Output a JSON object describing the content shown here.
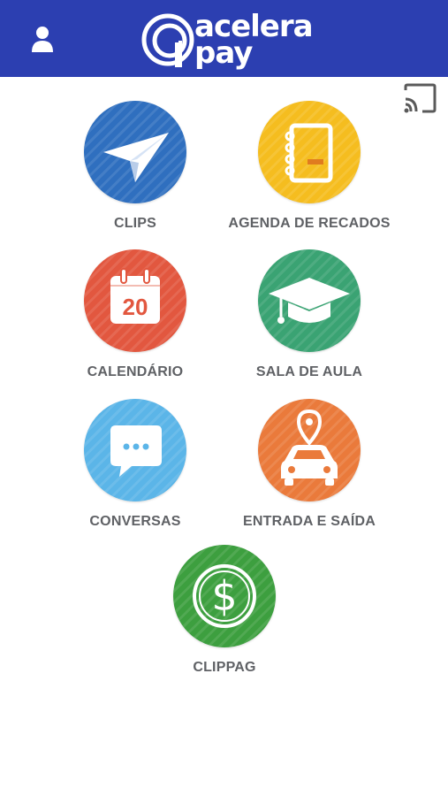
{
  "header": {
    "logo_word1": "acelera",
    "logo_word2": "pay",
    "background": "#2c3fb1"
  },
  "icons": {
    "user": "user-icon",
    "cast": "cast-icon"
  },
  "menu": [
    {
      "label": "CLIPS",
      "color": "#2f6fbf",
      "icon": "paper-plane-icon"
    },
    {
      "label": "AGENDA DE RECADOS",
      "color": "#f5bd1f",
      "icon": "notebook-icon"
    },
    {
      "label": "CALENDÁRIO",
      "color": "#e2573f",
      "icon": "calendar-icon",
      "day": "20"
    },
    {
      "label": "SALA DE AULA",
      "color": "#3aa373",
      "icon": "graduation-cap-icon"
    },
    {
      "label": "CONVERSAS",
      "color": "#5bb5e8",
      "icon": "chat-bubble-icon"
    },
    {
      "label": "ENTRADA E SAÍDA",
      "color": "#ea7a3b",
      "icon": "car-location-icon"
    },
    {
      "label": "CLIPPAG",
      "color": "#3d9f3f",
      "icon": "dollar-coin-icon",
      "symbol": "$"
    }
  ]
}
